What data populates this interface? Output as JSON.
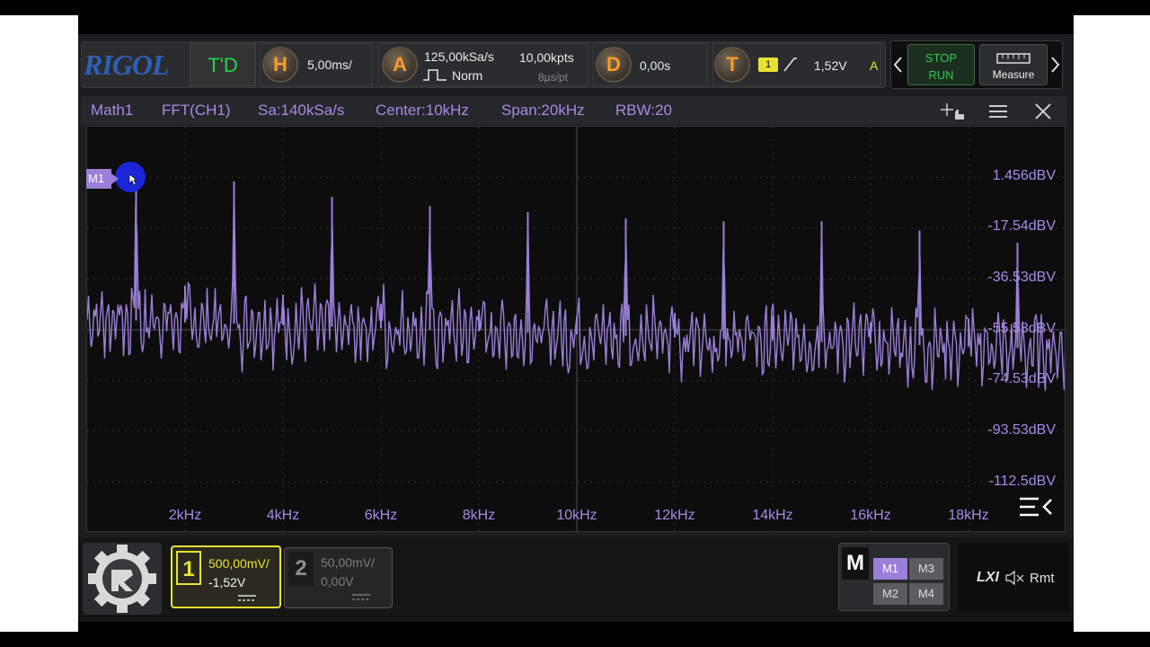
{
  "brand": "RIGOL",
  "top_bar": {
    "mode": "T'D",
    "horizontal": {
      "letter": "H",
      "timebase": "5,00ms/"
    },
    "acquire": {
      "letter": "A",
      "sample_rate": "125,00kSa/s",
      "mode": "Norm",
      "memory_depth": "10,00kpts",
      "time_per_point": "8µs/pt"
    },
    "delay": {
      "letter": "D",
      "value": "0,00s"
    },
    "trigger": {
      "letter": "T",
      "source": "1",
      "level": "1,52V",
      "sweep": "A"
    },
    "run_state": {
      "stop": "STOP",
      "run": "RUN"
    },
    "measure_label": "Measure"
  },
  "math_header": {
    "name": "Math1",
    "operation": "FFT(CH1)",
    "sample_rate": "Sa:140kSa/s",
    "center": "Center:10kHz",
    "span": "Span:20kHz",
    "rbw": "RBW:20"
  },
  "plot": {
    "y_labels": [
      "1.456dBV",
      "-17.54dBV",
      "-36.53dBV",
      "-55.53dBV",
      "-74.53dBV",
      "-93.53dBV",
      "-112.5dBV"
    ],
    "x_labels": [
      "2kHz",
      "4kHz",
      "6kHz",
      "8kHz",
      "10kHz",
      "12kHz",
      "14kHz",
      "16kHz",
      "18kHz"
    ],
    "marker": "M1",
    "trace_color": "#9b7fd8"
  },
  "chart_data": {
    "type": "line",
    "title": "",
    "xlabel": "",
    "ylabel": "",
    "xlim": [
      0,
      20000
    ],
    "ylim": [
      -122,
      11
    ],
    "series": [
      {
        "x": [
          1000,
          3000,
          5000,
          7000,
          9000,
          11000,
          13000,
          15000,
          17000,
          19000
        ],
        "values": [
          -2,
          -7,
          -12,
          -15,
          -17,
          -19,
          -20,
          -20,
          -23,
          -27
        ]
      },
      {
        "x": [
          2000,
          4000,
          6000,
          8000,
          10000,
          12000,
          14000,
          16000,
          18000
        ],
        "values": [
          -41,
          -44,
          -47,
          -49,
          -51,
          -50,
          -51,
          -53,
          -52
        ]
      }
    ]
  },
  "channels": [
    {
      "num": "1",
      "scale": "500,00mV/",
      "offset": "-1,52V",
      "color": "#e8e233"
    },
    {
      "num": "2",
      "scale": "50,00mV/",
      "offset": "0,00V",
      "color": "#7d7d7d"
    }
  ],
  "math_panel": {
    "label": "M",
    "buttons": [
      "M1",
      "M3",
      "M2",
      "M4"
    ]
  },
  "status": {
    "lxi": "LXI",
    "remote": "Rmt"
  }
}
